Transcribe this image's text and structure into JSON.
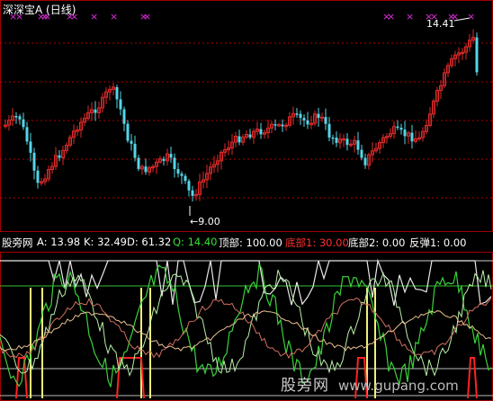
{
  "window": {
    "title": "深深宝A (日线)"
  },
  "price_panel": {
    "high_label": "14.41",
    "low_label": "←9.00",
    "colors": {
      "up": "#e02a2a",
      "down": "#54d6e8",
      "grid": "#b00000",
      "marker": "#e02ee0"
    },
    "marker_glyph": "×"
  },
  "indicator_header": {
    "items": [
      {
        "label": "股旁网",
        "color": "#ffffff"
      },
      {
        "label": "A: 13.98",
        "color": "#ffffff"
      },
      {
        "label": "K: 32.49",
        "color": "#ffffff"
      },
      {
        "label": "D: 61.32",
        "color": "#ffffff"
      },
      {
        "label": "Q: 14.40",
        "color": "#36e036"
      },
      {
        "label": "顶部: 100.00",
        "color": "#ffffff"
      },
      {
        "label": "底部1: 30.00",
        "color": "#ff3030"
      },
      {
        "label": "底部2: 0.00",
        "color": "#ffffff"
      },
      {
        "label": "反弹1: 0.00",
        "color": "#ffffff"
      }
    ]
  },
  "watermark": {
    "text": "股旁网",
    "url": "www.gupang.com"
  }
}
